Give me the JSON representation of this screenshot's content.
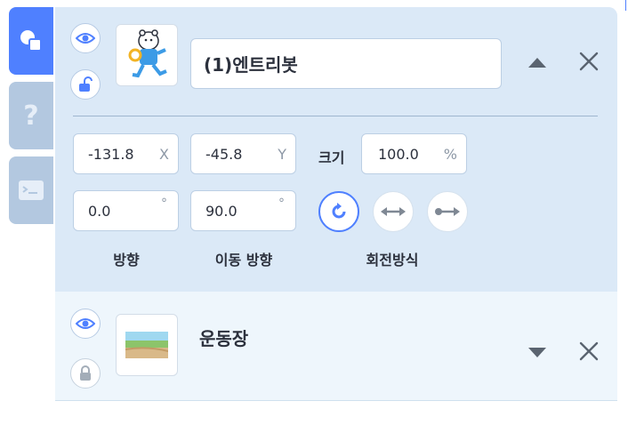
{
  "sidebar": {
    "tabs": [
      {
        "name": "object-tab",
        "icon": "shapes-icon",
        "active": true
      },
      {
        "name": "help-tab",
        "icon": "help-icon",
        "glyph": "?"
      },
      {
        "name": "console-tab",
        "icon": "console-icon"
      }
    ]
  },
  "objects": [
    {
      "name": "(1)엔트리봇",
      "visible_icon": "eye-icon",
      "lock_icon": "unlock-icon",
      "expanded": true,
      "x_value": "-131.8",
      "x_suffix": "X",
      "y_value": "-45.8",
      "y_suffix": "Y",
      "size_label": "크기",
      "size_value": "100.0",
      "size_suffix": "%",
      "direction_value": "0.0",
      "move_direction_value": "90.0",
      "degree_symbol": "°",
      "direction_label": "방향",
      "move_direction_label": "이동 방향",
      "rotation_label": "회전방식",
      "rotation_modes": [
        "rotate-free-icon",
        "flip-horizontal-icon",
        "no-rotate-icon"
      ],
      "rotation_selected": 0
    },
    {
      "name": "운동장",
      "visible_icon": "eye-icon",
      "lock_icon": "lock-icon",
      "expanded": false
    }
  ],
  "colors": {
    "accent": "#4f80ff",
    "panel_bg": "#dbe9f7",
    "card_light": "#eef6fc"
  }
}
